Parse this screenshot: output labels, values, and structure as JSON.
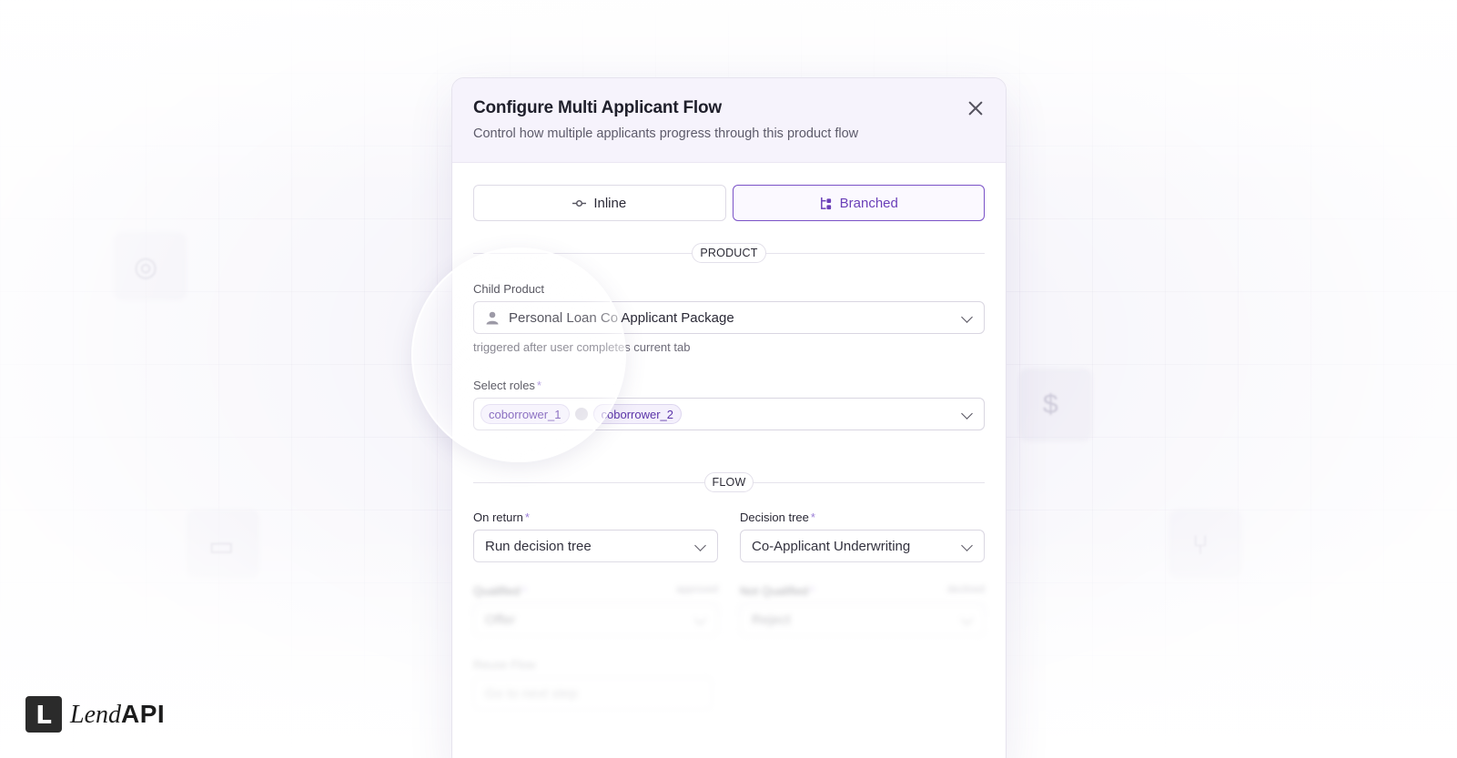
{
  "modal": {
    "title": "Configure Multi Applicant Flow",
    "subtitle": "Control how multiple applicants progress through this product flow",
    "close_icon": "close-icon"
  },
  "mode_toggle": {
    "inline_label": "Inline",
    "branched_label": "Branched",
    "selected": "Branched",
    "accent_color": "#6a3fb8"
  },
  "sections": {
    "product": "PRODUCT",
    "flow": "FLOW"
  },
  "child_product": {
    "label": "Child Product",
    "value": "Personal Loan Co Applicant Package",
    "helper": "triggered after user completes current tab"
  },
  "roles": {
    "label": "Select roles",
    "chips": [
      "coborrower_1",
      "coborrower_2"
    ]
  },
  "on_return": {
    "label": "On return",
    "value": "Run decision tree"
  },
  "decision_tree": {
    "label": "Decision tree",
    "value": "Co-Applicant Underwriting"
  },
  "qualified": {
    "label": "Qualified",
    "tag": "approved",
    "value": "Offer"
  },
  "not_qualified": {
    "label": "Not Qualified",
    "tag": "declined",
    "value": "Reject"
  },
  "reuse_flow": {
    "label": "Reuse Flow",
    "value": "Go to next step"
  },
  "logo": {
    "mark": "L",
    "lend": "Lend",
    "api": "API"
  }
}
